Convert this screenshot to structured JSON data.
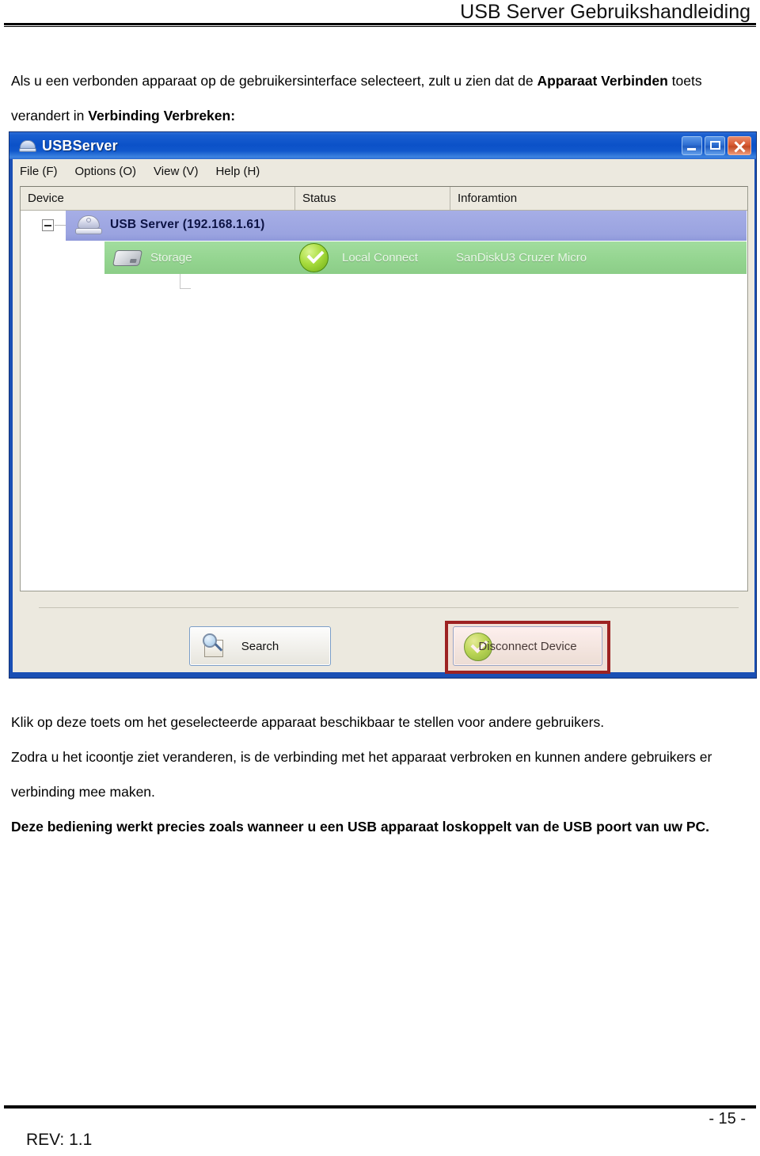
{
  "header": {
    "running_title": "USB Server Gebruikshandleiding"
  },
  "intro": {
    "part1": "Als u een verbonden apparaat op de gebruikersinterface selecteert, zult u zien dat de ",
    "bold1": "Apparaat Verbinden",
    "part2": " toets verandert in ",
    "bold2": "Verbinding Verbreken:"
  },
  "app": {
    "title": "USBServer",
    "title_icon": "usb-server-icon",
    "window_buttons": [
      {
        "name": "minimize-button",
        "glyph": "minimize-icon"
      },
      {
        "name": "maximize-button",
        "glyph": "maximize-icon"
      },
      {
        "name": "close-button",
        "glyph": "close-icon"
      }
    ],
    "menu": [
      {
        "label": "File (F)",
        "accel": "F"
      },
      {
        "label": "Options (O)",
        "accel": "O"
      },
      {
        "label": "View (V)",
        "accel": "V"
      },
      {
        "label": "Help (H)",
        "accel": "H"
      }
    ],
    "columns": [
      "Device",
      "Status",
      "Inforamtion"
    ],
    "tree": {
      "parent": {
        "label": "USB Server (192.168.1.61)",
        "expander": "collapse-minus-icon",
        "icon": "usb-server-device-icon",
        "selected": true
      },
      "child": {
        "device": "Storage",
        "status": "Local Connect",
        "information": "SanDiskU3 Cruzer Micro",
        "status_icon": "green-check-icon",
        "device_icon": "storage-drive-icon",
        "highlighted": true
      }
    },
    "buttons": {
      "search": {
        "label": "Search",
        "icon": "search-magnifier-icon"
      },
      "disconnect": {
        "label": "Disconnect Device",
        "icon": "green-check-icon",
        "highlighted": true
      }
    },
    "colors": {
      "titlebar": "#0b51c8",
      "window_border": "#1a4fb4",
      "panel": "#ece9df",
      "list_background": "#ffffff",
      "row_selected": "#9aa3e0",
      "row_connected": "#93d48f",
      "check_green": "#8ec924",
      "highlight_outline": "#9d2222"
    }
  },
  "body": {
    "para1": "Klik op deze toets om het geselecteerde apparaat beschikbaar te stellen voor andere gebruikers.",
    "para2": "Zodra u het icoontje ziet veranderen, is de verbinding met het apparaat verbroken en kunnen andere gebruikers er verbinding mee maken.",
    "para3": "Deze bediening werkt precies zoals wanneer u een USB apparaat loskoppelt van de USB poort van uw PC."
  },
  "footer": {
    "page_number": "- 15 -",
    "revision": "REV: 1.1"
  }
}
